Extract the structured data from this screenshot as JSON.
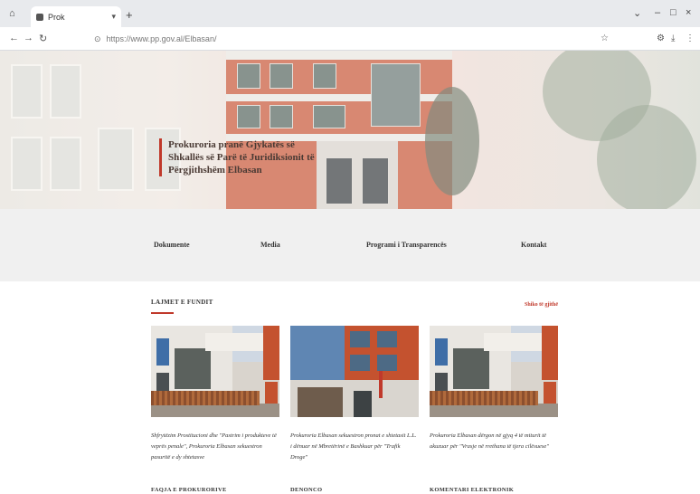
{
  "browser": {
    "tab_title": "Prok",
    "url": "https://www.pp.gov.al/Elbasan/"
  },
  "hero": {
    "title": "Prokuroria pranë Gjykatës së Shkallës së Parë të Juridiksionit të Përgjithshëm Elbasan"
  },
  "menu": {
    "items": [
      {
        "label": "Dokumente"
      },
      {
        "label": "Media"
      },
      {
        "label": "Programi i Transparencës"
      },
      {
        "label": "Kontakt"
      }
    ]
  },
  "news": {
    "title": "LAJMET E FUNDIT",
    "see_all": "Shiko të gjithë",
    "items": [
      {
        "caption": "Shfrytëzim Prostitucioni dhe \"Pastrim i produkteve të veprës penale\", Prokuroria Elbasan sekuestron pasuritë e dy shtetasve"
      },
      {
        "caption": "Prokuroria Elbasan sekuestron pronat e shtetasit L.L. i dënuar në Mbretërinë e Bashkuar për \"Trafik Droge\""
      },
      {
        "caption": "Prokuroria Elbasan dërgon në gjyq 4 të miturit të akuzuar për \"Vrasje në rrethana të tjera cilësuese\""
      }
    ]
  },
  "footer": {
    "headings": [
      "FAQJA E PROKURORIVE",
      "DENONCO",
      "KOMENTARI ELEKTRONIK"
    ]
  },
  "colors": {
    "accent": "#c0392b",
    "menu_band": "#f0f0f0"
  }
}
